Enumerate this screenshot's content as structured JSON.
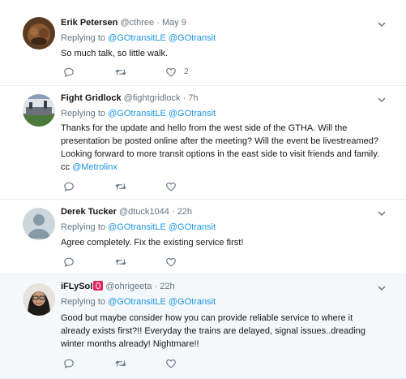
{
  "tweets": [
    {
      "name": "Erik Petersen",
      "handle": "@cthree",
      "dot": "·",
      "time": "May 9",
      "replying_label": "Replying to",
      "reply_to_1": "@GOtransitLE",
      "reply_to_2": "@GOtransit",
      "text": "So much talk, so little walk.",
      "like_count": "2"
    },
    {
      "name": "Fight Gridlock",
      "handle": "@fightgridlock",
      "dot": "·",
      "time": "7h",
      "replying_label": "Replying to",
      "reply_to_1": "@GOtransitLE",
      "reply_to_2": "@GOtransit",
      "text_line1": "Thanks for the update and hello from the west side of the GTHA. Will the",
      "text_line2": "presentation be posted online after the meeting? Will the event be livestreamed?",
      "text_line3": "Looking forward to more transit options in the east side to visit friends and family.",
      "text_line4_prefix": "cc",
      "text_line4_mention": "@Metrolinx"
    },
    {
      "name": "Derek Tucker",
      "handle": "@dtuck1044",
      "dot": "·",
      "time": "22h",
      "replying_label": "Replying to",
      "reply_to_1": "@GOtransitLE",
      "reply_to_2": "@GOtransit",
      "text": "Agree completely. Fix the existing service first!"
    },
    {
      "name": "iFLySoI",
      "handle": "@ohrigeeta",
      "dot": "·",
      "time": "22h",
      "replying_label": "Replying to",
      "reply_to_1": "@GOtransitLE",
      "reply_to_2": "@GOtransit",
      "text_line1": "Good but maybe consider how you can provide reliable service to where it",
      "text_line2": "already exists first?!! Everyday the trains are delayed, signal issues..dreading",
      "text_line3": "winter months already! Nightmare!!"
    }
  ],
  "colors": {
    "link": "#1b95e0",
    "muted": "#657786",
    "badge": "#e0245e",
    "highlight_bg": "#f5f8fa"
  },
  "icons": {
    "reply": "reply-icon",
    "retweet": "retweet-icon",
    "like": "heart-icon",
    "caret": "chevron-down-icon",
    "verified_badge": "red-badge-icon"
  }
}
